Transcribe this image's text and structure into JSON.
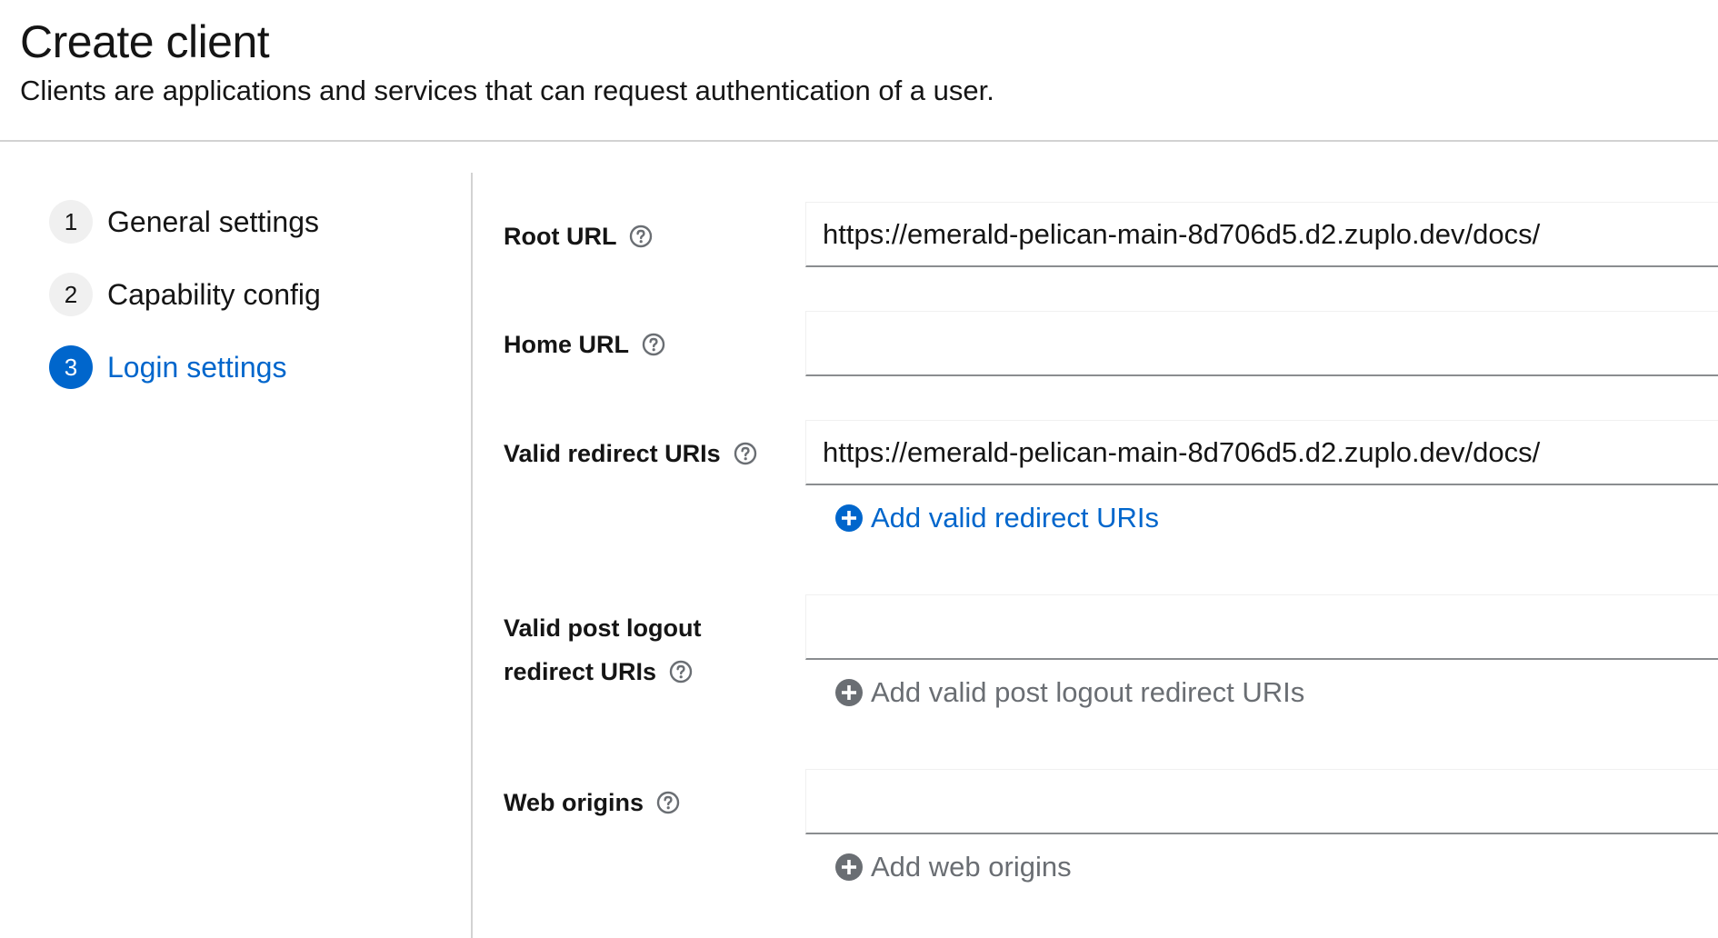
{
  "header": {
    "title": "Create client",
    "description": "Clients are applications and services that can request authentication of a user."
  },
  "wizard": {
    "steps": [
      {
        "number": "1",
        "label": "General settings"
      },
      {
        "number": "2",
        "label": "Capability config"
      },
      {
        "number": "3",
        "label": "Login settings"
      }
    ],
    "current_step": "3"
  },
  "form": {
    "root_url": {
      "label": "Root URL",
      "value": "https://emerald-pelican-main-8d706d5.d2.zuplo.dev/docs/"
    },
    "home_url": {
      "label": "Home URL",
      "value": ""
    },
    "valid_redirect_uris": {
      "label": "Valid redirect URIs",
      "value": "https://emerald-pelican-main-8d706d5.d2.zuplo.dev/docs/",
      "add_label": "Add valid redirect URIs"
    },
    "valid_post_logout_redirect_uris": {
      "label_line1": "Valid post logout",
      "label_line2": "redirect URIs",
      "value": "",
      "add_label": "Add valid post logout redirect URIs"
    },
    "web_origins": {
      "label": "Web origins",
      "value": "",
      "add_label": "Add web origins"
    }
  },
  "icons": {
    "help": "question-circle-icon",
    "add": "plus-circle-icon"
  },
  "colors": {
    "accent": "#0066cc",
    "disabled": "#6a6e73",
    "border": "#d2d2d2",
    "input_underline": "#8a8d90"
  }
}
